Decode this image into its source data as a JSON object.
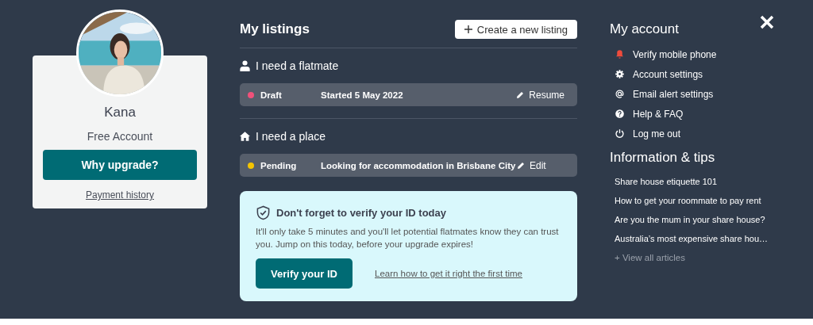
{
  "profile": {
    "name": "Kana",
    "account_type": "Free Account",
    "upgrade_button": "Why upgrade?",
    "payment_link": "Payment history"
  },
  "listings": {
    "title": "My listings",
    "create_button": "Create a new listing",
    "groups": [
      {
        "kind": "flatmate",
        "title": "I need a flatmate",
        "items": [
          {
            "status": "Draft",
            "color": "#f0517a",
            "description": "Started 5 May 2022",
            "action": "Resume"
          }
        ]
      },
      {
        "kind": "place",
        "title": "I need a place",
        "items": [
          {
            "status": "Pending",
            "color": "#f5c400",
            "description": "Looking for accommodation in Brisbane City",
            "action": "Edit"
          }
        ]
      }
    ]
  },
  "verify_card": {
    "title": "Don't forget to verify your ID today",
    "body": "It'll only take 5 minutes and you'll let potential flatmates know they can trust you. Jump on this today, before your upgrade expires!",
    "button": "Verify your ID",
    "link": "Learn how to get it right the first time"
  },
  "account": {
    "title": "My account",
    "items": [
      {
        "kind": "bell",
        "label": "Verify mobile phone"
      },
      {
        "kind": "gear",
        "label": "Account settings"
      },
      {
        "kind": "at",
        "label": "Email alert settings"
      },
      {
        "kind": "help",
        "label": "Help & FAQ"
      },
      {
        "kind": "power",
        "label": "Log me out"
      }
    ]
  },
  "tips": {
    "title": "Information & tips",
    "articles": [
      "Share house etiquette 101",
      "How to get your roommate to pay rent",
      "Are you the mum in your share house?",
      "Australia’s most expensive share hou…"
    ],
    "more_link": "+ View all articles"
  }
}
